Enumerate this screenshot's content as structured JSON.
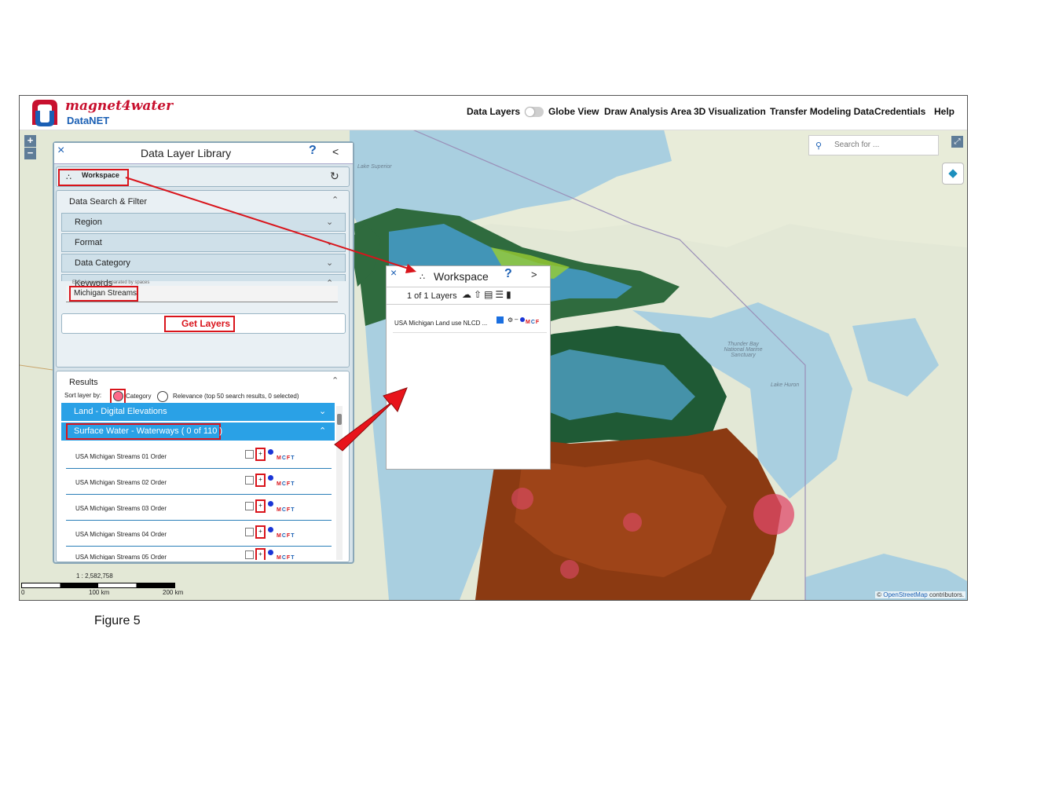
{
  "brand": {
    "name": "magnet4water",
    "sub": "DataNET"
  },
  "nav": {
    "data_layers": "Data Layers",
    "globe_view": "Globe View",
    "draw_analysis": "Draw Analysis Area",
    "viz_3d": "3D Visualization",
    "transfer": "Transfer Modeling Data",
    "credentials": "Credentials",
    "help": "Help"
  },
  "map": {
    "zoom_in": "+",
    "zoom_out": "−",
    "search_placeholder": "Search for ...",
    "scale_ratio": "1 : 2,582,758",
    "scale_ticks": [
      "0",
      "100 km",
      "200 km"
    ],
    "attribution_prefix": "©",
    "attribution_osm": "OpenStreetMap",
    "attribution_suffix": "contributors.",
    "labels": [
      "Lake Superior",
      "Lake Huron",
      "Thunder Bay National Marine Sanctuary"
    ]
  },
  "library": {
    "title": "Data Layer Library",
    "help": "?",
    "collapse": "<",
    "close": "×",
    "workspace_label": "Workspace",
    "search_title": "Data Search & Filter",
    "filters": [
      "Region",
      "Format",
      "Data Category",
      "Keywords"
    ],
    "keyword_hint": "Enter keywords separated by spaces",
    "keyword_value": "Michigan Streams",
    "get_layers": "Get Layers",
    "results_title": "Results",
    "sort_prefix": "Sort layer by:",
    "sort_category": "Category",
    "sort_relevance": "Relevance (top 50 search results, 0 selected)",
    "groups": [
      "Land - Digital Elevations",
      "Surface Water - Waterways ( 0 of 110 )"
    ],
    "results": [
      "USA Michigan Streams 01 Order",
      "USA Michigan Streams 02 Order",
      "USA Michigan Streams 03 Order",
      "USA Michigan Streams 04 Order",
      "USA Michigan Streams 05 Order"
    ],
    "mcft": [
      "M",
      "C",
      "F",
      "T"
    ]
  },
  "workspace": {
    "close": "×",
    "title": "Workspace",
    "help": "?",
    "next": ">",
    "count": "1 of 1 Layers",
    "layer": "USA Michigan Land use NLCD ...",
    "mcf": [
      "M",
      "C",
      "F"
    ]
  },
  "caption": "Figure 5",
  "colors": {
    "accent": "#2aa1e6",
    "annotation": "#d9141b",
    "brand_red": "#c8102e",
    "brand_blue": "#1a5fb4"
  }
}
